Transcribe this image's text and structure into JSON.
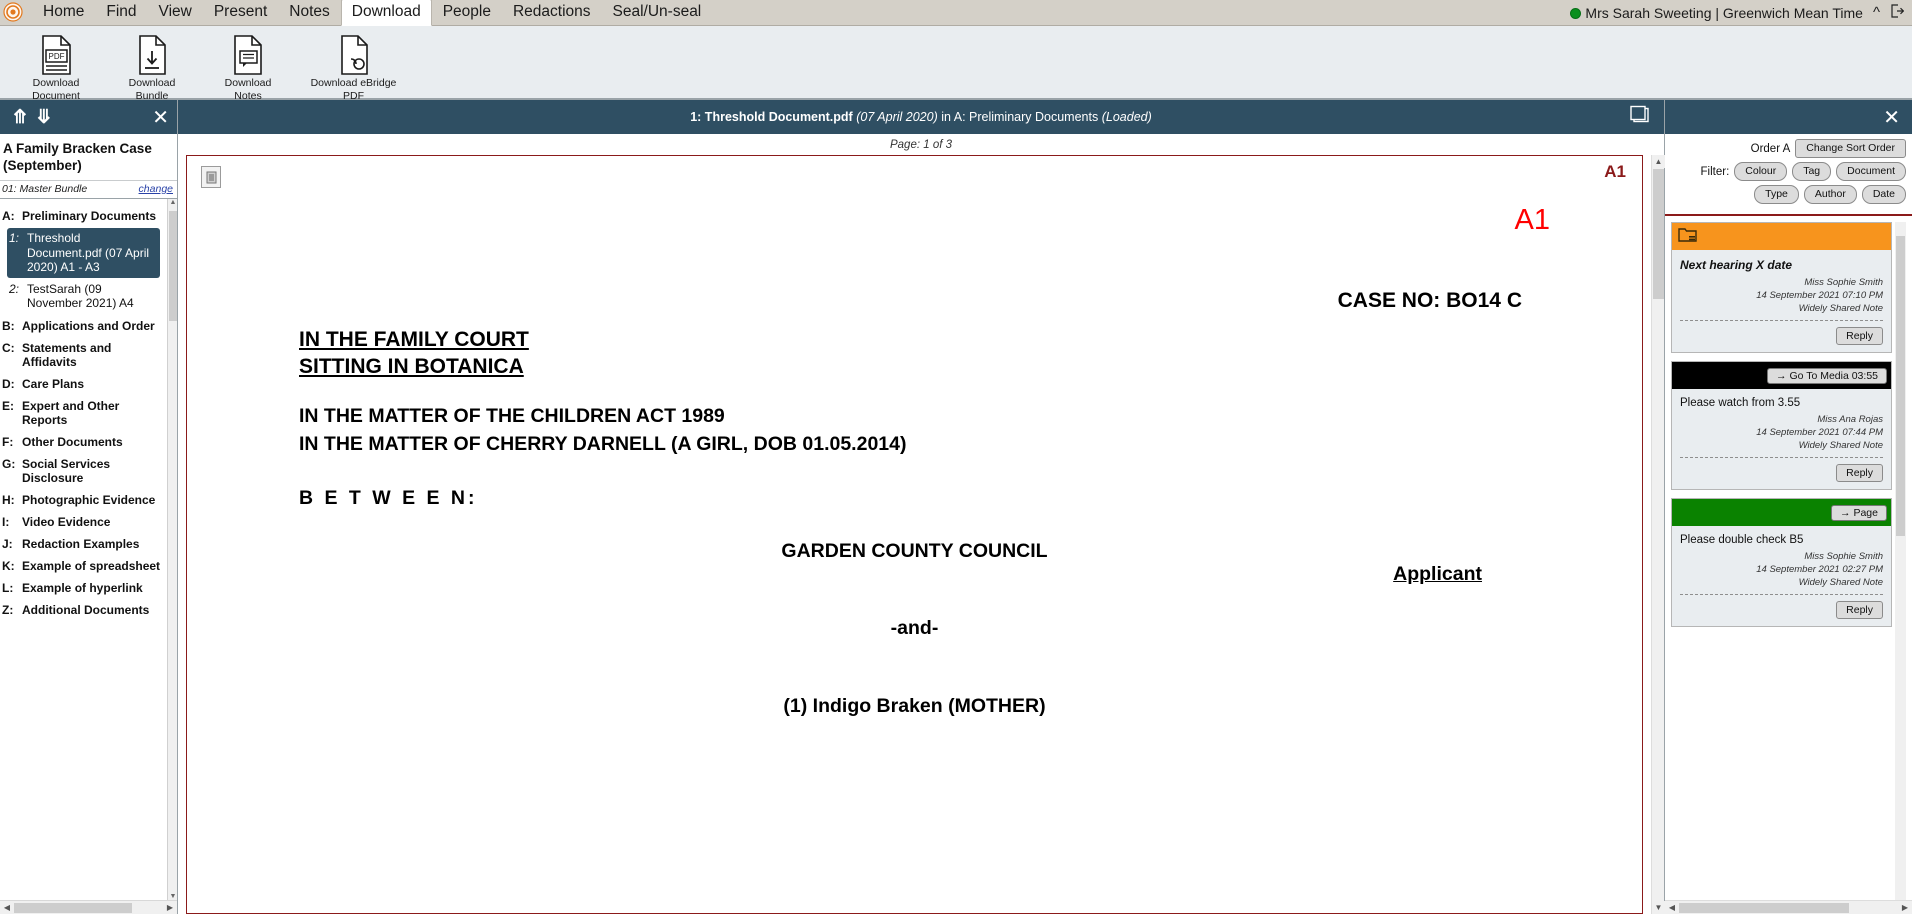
{
  "menu": {
    "logo_icon": "app-logo-icon",
    "items": [
      {
        "label": "Home",
        "active": false
      },
      {
        "label": "Find",
        "active": false
      },
      {
        "label": "View",
        "active": false
      },
      {
        "label": "Present",
        "active": false
      },
      {
        "label": "Notes",
        "active": false
      },
      {
        "label": "Download",
        "active": true
      },
      {
        "label": "People",
        "active": false
      },
      {
        "label": "Redactions",
        "active": false
      },
      {
        "label": "Seal/Un-seal",
        "active": false
      }
    ],
    "user_status": "Mrs Sarah Sweeting | Greenwich Mean Time",
    "status_color": "#0a8f1e",
    "collapse_icon": "chevron-up-icon",
    "logout_icon": "logout-icon"
  },
  "ribbon": {
    "buttons": [
      {
        "icon": "pdf-document-icon",
        "line1": "Download",
        "line2": "Document"
      },
      {
        "icon": "download-bundle-icon",
        "line1": "Download",
        "line2": "Bundle"
      },
      {
        "icon": "download-notes-icon",
        "line1": "Download",
        "line2": "Notes"
      },
      {
        "icon": "download-ebridge-icon",
        "line1": "Download eBridge",
        "line2": "PDF"
      }
    ]
  },
  "sidebar": {
    "collapse_all_icon": "chevrons-up-icon",
    "expand_all_icon": "chevrons-down-icon",
    "close_icon": "close-icon",
    "case_title": "A Family Bracken Case (September)",
    "bundle_name": "01: Master Bundle",
    "bundle_change_label": "change",
    "tree": [
      {
        "type": "section",
        "key": "A:",
        "label": "Preliminary Documents"
      },
      {
        "type": "doc",
        "key": "1:",
        "label": "Threshold Document.pdf (07 April 2020) A1 - A3",
        "selected": true
      },
      {
        "type": "doc",
        "key": "2:",
        "label": "TestSarah (09 November 2021) A4",
        "selected": false
      },
      {
        "type": "section",
        "key": "B:",
        "label": "Applications and Order"
      },
      {
        "type": "section",
        "key": "C:",
        "label": "Statements and Affidavits"
      },
      {
        "type": "section",
        "key": "D:",
        "label": "Care Plans"
      },
      {
        "type": "section",
        "key": "E:",
        "label": "Expert and Other Reports"
      },
      {
        "type": "section",
        "key": "F:",
        "label": "Other Documents"
      },
      {
        "type": "section",
        "key": "G:",
        "label": "Social Services Disclosure"
      },
      {
        "type": "section",
        "key": "H:",
        "label": "Photographic Evidence"
      },
      {
        "type": "section",
        "key": "I:",
        "label": "Video Evidence"
      },
      {
        "type": "section",
        "key": "J:",
        "label": "Redaction Examples"
      },
      {
        "type": "section",
        "key": "K:",
        "label": "Example of spreadsheet"
      },
      {
        "type": "section",
        "key": "L:",
        "label": "Example of hyperlink"
      },
      {
        "type": "section",
        "key": "Z:",
        "label": "Additional Documents"
      }
    ]
  },
  "viewer": {
    "header": {
      "name": "1: Threshold Document.pdf",
      "date": "(07 April 2020)",
      "in_text": "in A: Preliminary Documents",
      "state": "(Loaded)",
      "split_view_icon": "split-view-icon"
    },
    "page_label": "Page: 1 of 3",
    "tool_icon": "page-tool-icon",
    "page_ref": "A1",
    "document": {
      "stamp": "A1",
      "case_no": "CASE NO: BO14 C",
      "court_line1": "IN THE FAMILY COURT",
      "court_line2": "SITTING IN BOTANICA",
      "matter_line1": "IN THE MATTER OF THE CHILDREN ACT 1989",
      "matter_line2": "IN THE MATTER OF CHERRY DARNELL (A GIRL, DOB 01.05.2014)",
      "between": "B E T W E E N:",
      "party_applicant": "GARDEN COUNTY COUNCIL",
      "applicant_label": "Applicant",
      "and_separator": "-and-",
      "party_respondent": "(1) Indigo Braken  (MOTHER)"
    },
    "stamp_color": "#ff0000",
    "page_ref_color": "#8b1a1a"
  },
  "notes": {
    "close_icon": "close-icon",
    "order_label": "Order A",
    "change_sort_label": "Change Sort Order",
    "filter_label": "Filter:",
    "filter_pills_row1": [
      "Colour",
      "Tag",
      "Document"
    ],
    "filter_pills_row2": [
      "Type",
      "Author",
      "Date"
    ],
    "cards": [
      {
        "banner_color": "#f7941d",
        "banner_style": "orange",
        "banner_icon": "note-folder-icon",
        "banner_button": "",
        "text": "Next hearing X date",
        "text_style": "bold-italic",
        "author": "Miss Sophie Smith",
        "timestamp": "14 September 2021 07:10 PM",
        "share": "Widely Shared Note",
        "reply_label": "Reply"
      },
      {
        "banner_color": "#000000",
        "banner_style": "black",
        "banner_icon": "",
        "banner_button": "→  Go To Media 03:55",
        "text": "Please watch from 3.55",
        "text_style": "normal",
        "author": "Miss Ana Rojas",
        "timestamp": "14 September 2021 07:44 PM",
        "share": "Widely Shared Note",
        "reply_label": "Reply"
      },
      {
        "banner_color": "#0a8200",
        "banner_style": "green",
        "banner_icon": "",
        "banner_button": "→  Page",
        "text": "Please double check B5",
        "text_style": "normal",
        "author": "Miss Sophie Smith",
        "timestamp": "14 September 2021 02:27 PM",
        "share": "Widely Shared Note",
        "reply_label": "Reply"
      }
    ]
  }
}
